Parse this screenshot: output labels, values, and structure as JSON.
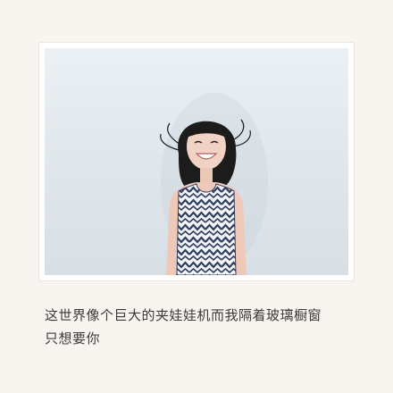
{
  "post": {
    "caption_lines": [
      "这世界像个巨大的夹娃娃机而我隔着玻璃橱窗",
      "只想要你"
    ]
  }
}
